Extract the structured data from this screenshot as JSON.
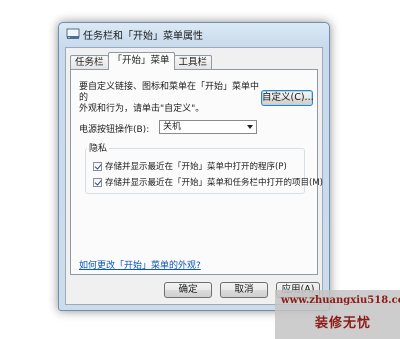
{
  "window": {
    "title": "任务栏和「开始」菜单属性",
    "icon": "taskbar-properties-icon"
  },
  "tabs": [
    {
      "label": "任务栏",
      "active": false
    },
    {
      "label": "「开始」菜单",
      "active": true
    },
    {
      "label": "工具栏",
      "active": false
    }
  ],
  "start_menu": {
    "intro_line1": "要自定义链接、图标和菜单在「开始」菜单中的",
    "intro_line2": "外观和行为，请单击\"自定义\"。",
    "customize_button": "自定义(C)...",
    "power_label": "电源按钮操作(B):",
    "power_value": "关机",
    "privacy_title": "隐私",
    "privacy_options": [
      {
        "label": "存储并显示最近在「开始」菜单中打开的程序(P)",
        "checked": true
      },
      {
        "label": "存储并显示最近在「开始」菜单和任务栏中打开的项目(M)",
        "checked": true
      }
    ],
    "help_link": "如何更改「开始」菜单的外观?"
  },
  "footer": {
    "ok_button": "确定",
    "cancel_button": "取消",
    "apply_button": "应用(A)"
  },
  "watermark": {
    "url": "www.zhuangxiu518.com",
    "text": "装修无忧"
  },
  "colors": {
    "link": "#0d55b8",
    "watermark_text": "#8b1c17",
    "checkmark": "#264a82"
  }
}
